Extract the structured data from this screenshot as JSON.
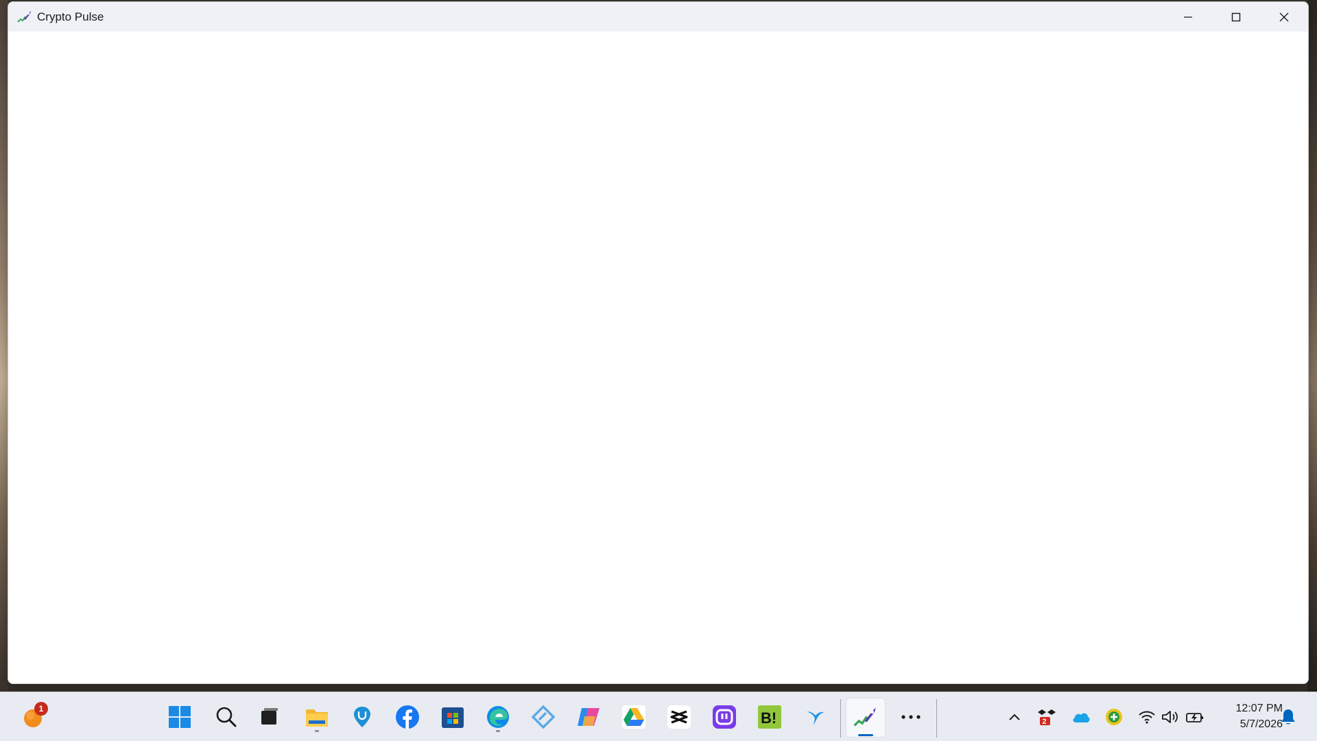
{
  "window": {
    "title": "Crypto Pulse",
    "app_icon": "rocket-chart-icon"
  },
  "taskbar": {
    "widgets_badge": "1",
    "pinned": [
      {
        "name": "windows-start-icon"
      },
      {
        "name": "search-icon"
      },
      {
        "name": "task-view-icon"
      },
      {
        "name": "file-explorer-icon"
      },
      {
        "name": "pin-app-icon"
      },
      {
        "name": "facebook-icon"
      },
      {
        "name": "microsoft-store-icon"
      },
      {
        "name": "edge-browser-icon"
      },
      {
        "name": "link-app-icon"
      },
      {
        "name": "copilot-icon"
      },
      {
        "name": "google-drive-icon"
      },
      {
        "name": "capcut-icon"
      },
      {
        "name": "podcast-app-icon"
      },
      {
        "name": "bi-app-icon"
      },
      {
        "name": "bird-app-icon"
      },
      {
        "name": "crypto-pulse-icon"
      },
      {
        "name": "more-icon"
      }
    ]
  },
  "tray": {
    "dropbox_badge": "2",
    "time": "12:07 PM",
    "date": "5/7/2026"
  },
  "colors": {
    "titlebar": "#eff1f6",
    "taskbar": "#e8ebf1",
    "accent": "#0067c0"
  }
}
